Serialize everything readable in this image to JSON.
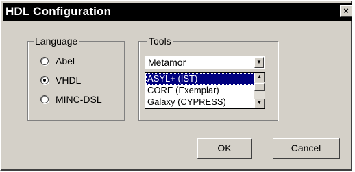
{
  "window": {
    "title": "HDL Configuration",
    "close_label": "×"
  },
  "language_group": {
    "legend": "Language",
    "options": [
      {
        "label": "Abel",
        "checked": false
      },
      {
        "label": "VHDL",
        "checked": true
      },
      {
        "label": "MINC-DSL",
        "checked": false
      }
    ]
  },
  "tools_group": {
    "legend": "Tools",
    "combo_value": "Metamor",
    "list_items": [
      {
        "label": "ASYL+ (IST)",
        "selected": true
      },
      {
        "label": "CORE (Exemplar)",
        "selected": false
      },
      {
        "label": "Galaxy (CYPRESS)",
        "selected": false
      }
    ]
  },
  "buttons": {
    "ok": "OK",
    "cancel": "Cancel"
  }
}
